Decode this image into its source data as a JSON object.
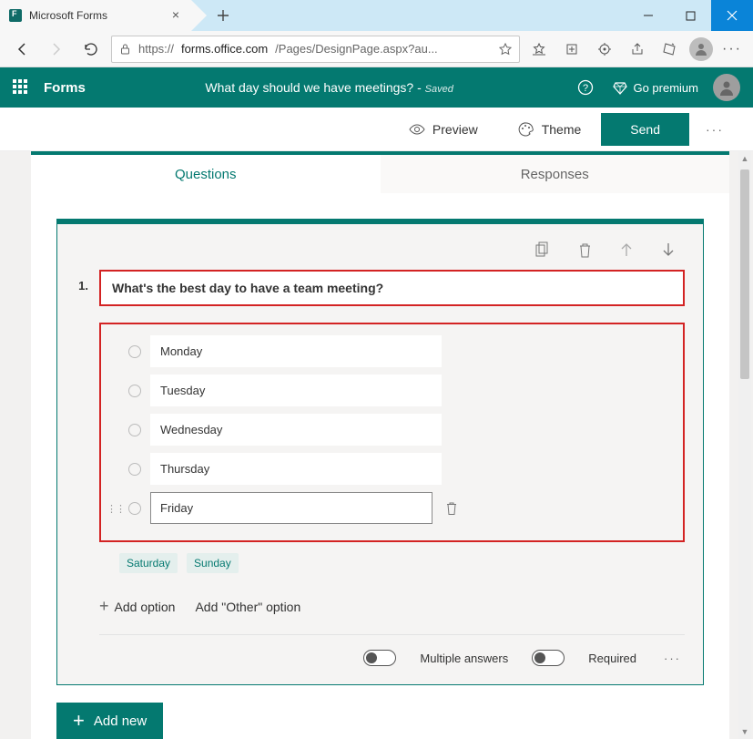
{
  "browser": {
    "tab_title": "Microsoft Forms",
    "url_proto": "https://",
    "url_host": "forms.office.com",
    "url_path": "/Pages/DesignPage.aspx?au..."
  },
  "header": {
    "brand": "Forms",
    "doc_title": "What day should we have meetings? - ",
    "status": "Saved",
    "premium": "Go premium"
  },
  "actions": {
    "preview": "Preview",
    "theme": "Theme",
    "send": "Send"
  },
  "tabs": {
    "questions": "Questions",
    "responses": "Responses"
  },
  "question": {
    "number": "1.",
    "text": "What's the best day to have a team meeting?",
    "options": [
      "Monday",
      "Tuesday",
      "Wednesday",
      "Thursday"
    ],
    "editing_option": "Friday",
    "suggestions": [
      "Saturday",
      "Sunday"
    ],
    "add_option": "Add option",
    "add_other": "Add \"Other\" option",
    "multi_label": "Multiple answers",
    "required_label": "Required"
  },
  "footer": {
    "add_new": "Add new"
  }
}
